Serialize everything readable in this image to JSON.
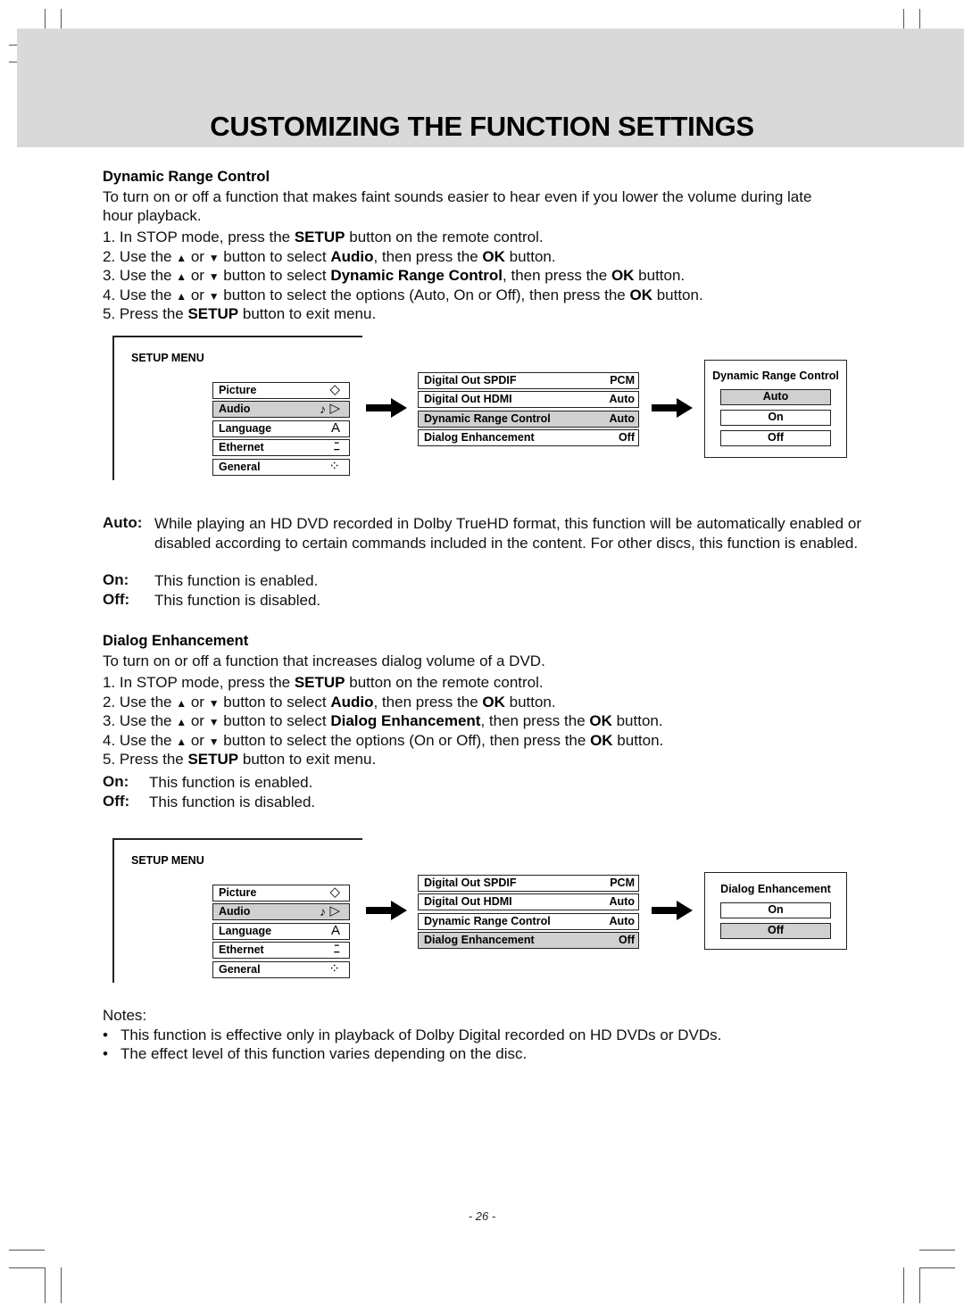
{
  "page": {
    "title": "CUSTOMIZING THE FUNCTION SETTINGS",
    "page_number": "- 26 -"
  },
  "drc": {
    "heading": "Dynamic Range Control",
    "intro_line1": "To turn on or off a function that makes faint sounds easier to hear even if you lower the volume during late",
    "intro_line2": "hour playback.",
    "steps": [
      {
        "num": "1.",
        "pre": "In STOP mode, press the ",
        "bold": "SETUP",
        "post": " button on the remote control."
      },
      {
        "num": "2.",
        "pre": "Use the ",
        "up": "▲",
        "or": " or ",
        "down": "▼",
        "mid": " button to select ",
        "bold": "Audio",
        "mid2": ", then press the ",
        "bold2": "OK",
        "post": " button."
      },
      {
        "num": "3.",
        "pre": "Use the ",
        "up": "▲",
        "or": " or ",
        "down": "▼",
        "mid": " button to select ",
        "bold": "Dynamic Range Control",
        "mid2": ", then press the ",
        "bold2": "OK",
        "post": " button."
      },
      {
        "num": "4.",
        "pre": "Use the ",
        "up": "▲",
        "or": " or ",
        "down": "▼",
        "mid": " button to select the options (Auto, On or Off), then press the ",
        "bold2": "OK",
        "post": " button."
      },
      {
        "num": "5.",
        "pre": "Press the ",
        "bold": "SETUP",
        "post": " button to exit menu."
      }
    ],
    "definitions": [
      {
        "term": "Auto:",
        "desc": "While playing an HD DVD recorded in Dolby TrueHD format, this function will be automatically enabled or disabled according to certain commands included in the content. For other discs, this function is enabled."
      },
      {
        "term": "On:",
        "desc": "This function is enabled."
      },
      {
        "term": "Off:",
        "desc": "This function is disabled."
      }
    ],
    "diagram": {
      "setup_label": "SETUP MENU",
      "menu": [
        {
          "label": "Picture",
          "icon": "◇",
          "icon_name": "picture-diamond-icon",
          "selected": false
        },
        {
          "label": "Audio",
          "icon": "▷",
          "icon2": "♪",
          "icon_name": "audio-music-icon",
          "selected": true
        },
        {
          "label": "Language",
          "icon": "A",
          "icon_name": "language-a-icon",
          "selected": false
        },
        {
          "label": "Ethernet",
          "icon": "ﾆ",
          "icon_name": "ethernet-zigzag-icon",
          "selected": false
        },
        {
          "label": "General",
          "icon": "⁘",
          "icon_name": "general-dots-icon",
          "selected": false
        }
      ],
      "submenu": [
        {
          "label": "Digital Out SPDIF",
          "value": "PCM",
          "selected": false
        },
        {
          "label": "Digital Out HDMI",
          "value": "Auto",
          "selected": false
        },
        {
          "label": "Dynamic Range Control",
          "value": "Auto",
          "selected": true
        },
        {
          "label": "Dialog Enhancement",
          "value": "Off",
          "selected": false
        }
      ],
      "options_title": "Dynamic Range Control",
      "options": [
        {
          "label": "Auto",
          "selected": true
        },
        {
          "label": "On",
          "selected": false
        },
        {
          "label": "Off",
          "selected": false
        }
      ]
    }
  },
  "de": {
    "heading": "Dialog Enhancement",
    "intro": "To turn on or off a function that increases dialog volume of a DVD.",
    "steps": [
      {
        "num": "1.",
        "pre": "In STOP mode, press the ",
        "bold": "SETUP",
        "post": " button on the remote control."
      },
      {
        "num": "2.",
        "pre": "Use the ",
        "up": "▲",
        "or": " or ",
        "down": "▼",
        "mid": " button to select ",
        "bold": "Audio",
        "mid2": ", then press the ",
        "bold2": "OK",
        "post": " button."
      },
      {
        "num": "3.",
        "pre": "Use the ",
        "up": "▲",
        "or": " or ",
        "down": "▼",
        "mid": " button to select ",
        "bold": "Dialog Enhancement",
        "mid2": ", then press the ",
        "bold2": "OK",
        "post": " button."
      },
      {
        "num": "4.",
        "pre": "Use the ",
        "up": "▲",
        "or": " or ",
        "down": "▼",
        "mid": " button to select the options (On or Off), then press the ",
        "bold2": "OK",
        "post": " button."
      },
      {
        "num": "5.",
        "pre": "Press the ",
        "bold": "SETUP",
        "post": " button to exit menu."
      }
    ],
    "definitions": [
      {
        "term": "On:",
        "desc": "This function is enabled."
      },
      {
        "term": "Off:",
        "desc": "This function is disabled."
      }
    ],
    "diagram": {
      "setup_label": "SETUP MENU",
      "menu": [
        {
          "label": "Picture",
          "icon": "◇",
          "selected": false
        },
        {
          "label": "Audio",
          "icon": "▷",
          "icon2": "♪",
          "selected": true
        },
        {
          "label": "Language",
          "icon": "A",
          "selected": false
        },
        {
          "label": "Ethernet",
          "icon": "ﾆ",
          "selected": false
        },
        {
          "label": "General",
          "icon": "⁘",
          "selected": false
        }
      ],
      "submenu": [
        {
          "label": "Digital Out SPDIF",
          "value": "PCM",
          "selected": false
        },
        {
          "label": "Digital Out HDMI",
          "value": "Auto",
          "selected": false
        },
        {
          "label": "Dynamic Range Control",
          "value": "Auto",
          "selected": false
        },
        {
          "label": "Dialog Enhancement",
          "value": "Off",
          "selected": true
        }
      ],
      "options_title": "Dialog Enhancement",
      "options": [
        {
          "label": "On",
          "selected": false
        },
        {
          "label": "Off",
          "selected": true
        }
      ]
    }
  },
  "notes": {
    "title": "Notes:",
    "bullet": "•",
    "items": [
      "This function is effective only in playback of Dolby Digital recorded on HD DVDs or DVDs.",
      "The effect level of this function varies depending on the disc."
    ]
  }
}
